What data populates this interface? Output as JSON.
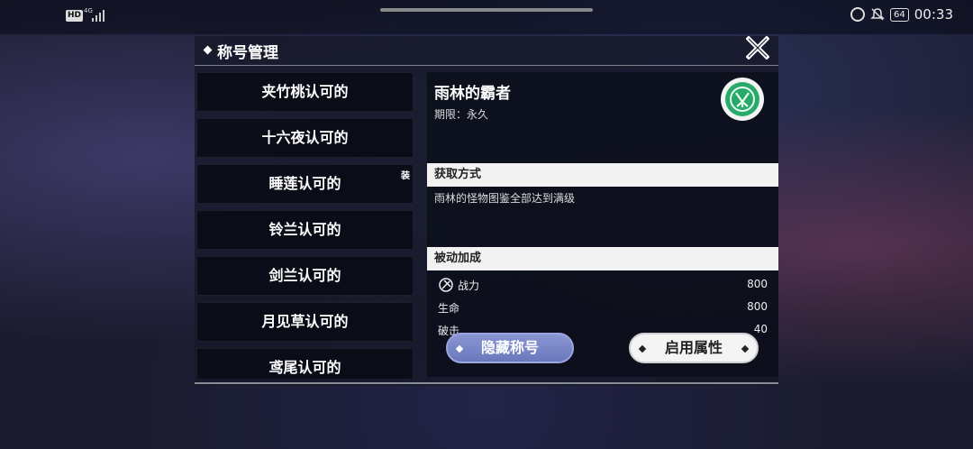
{
  "status_bar": {
    "hd": "HD",
    "network": "4G",
    "battery": "64",
    "time": "00:33"
  },
  "panel": {
    "title": "称号管理"
  },
  "title_list": [
    {
      "label": "夹竹桃认可的",
      "equipped": false
    },
    {
      "label": "十六夜认可的",
      "equipped": false
    },
    {
      "label": "睡莲认可的",
      "equipped": true
    },
    {
      "label": "铃兰认可的",
      "equipped": false
    },
    {
      "label": "剑兰认可的",
      "equipped": false
    },
    {
      "label": "月见草认可的",
      "equipped": false
    },
    {
      "label": "鸢尾认可的",
      "equipped": false
    }
  ],
  "equipped_badge": "装",
  "detail": {
    "name": "雨林的霸者",
    "period": "期限：永久",
    "acquire_header": "获取方式",
    "acquire_text": "雨林的怪物图鉴全部达到满级",
    "bonus_header": "被动加成",
    "stats": [
      {
        "name": "战力",
        "value": "800"
      },
      {
        "name": "生命",
        "value": "800"
      },
      {
        "name": "破击",
        "value": "40"
      }
    ]
  },
  "buttons": {
    "hide": "隐藏称号",
    "enable": "启用属性"
  },
  "colors": {
    "hide_button": "#7a86c8",
    "emblem": "#2aaa6a",
    "section_bar": "#f2f2f2"
  }
}
